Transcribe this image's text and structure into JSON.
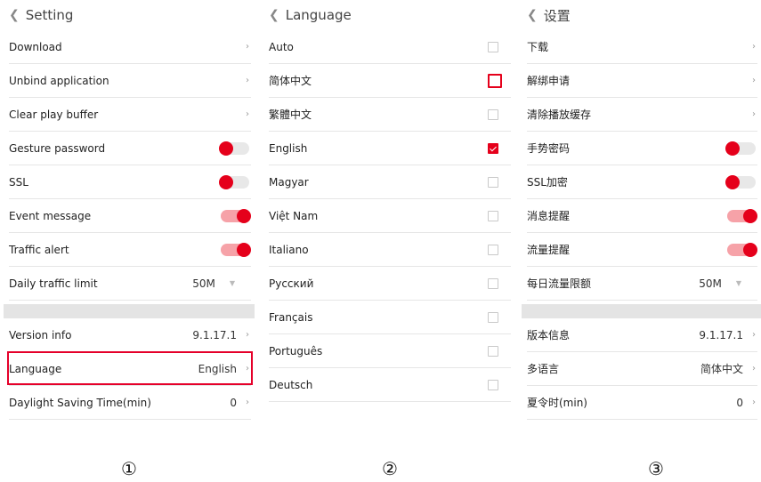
{
  "panel1": {
    "title": "Setting",
    "rows": [
      {
        "label": "Download"
      },
      {
        "label": "Unbind application"
      },
      {
        "label": "Clear play buffer"
      },
      {
        "label": "Gesture password",
        "toggle": "off"
      },
      {
        "label": "SSL",
        "toggle": "off"
      },
      {
        "label": "Event message",
        "toggle": "on"
      },
      {
        "label": "Traffic alert",
        "toggle": "on"
      },
      {
        "label": "Daily traffic limit",
        "value": "50M"
      }
    ],
    "rows2": [
      {
        "label": "Version info",
        "value": "9.1.17.1"
      },
      {
        "label": "Language",
        "value": "English"
      },
      {
        "label": "Daylight Saving Time(min)",
        "value": "0"
      }
    ]
  },
  "panel2": {
    "title": "Language",
    "languages": [
      {
        "label": "Auto",
        "state": "unchecked"
      },
      {
        "label": "简体中文",
        "state": "focus"
      },
      {
        "label": "繁體中文",
        "state": "unchecked"
      },
      {
        "label": "English",
        "state": "checked"
      },
      {
        "label": "Magyar",
        "state": "unchecked"
      },
      {
        "label": "Việt Nam",
        "state": "unchecked"
      },
      {
        "label": "Italiano",
        "state": "unchecked"
      },
      {
        "label": "Русский",
        "state": "unchecked"
      },
      {
        "label": "Français",
        "state": "unchecked"
      },
      {
        "label": "Português",
        "state": "unchecked"
      },
      {
        "label": "Deutsch",
        "state": "unchecked"
      }
    ]
  },
  "panel3": {
    "title": "设置",
    "rows": [
      {
        "label": "下载"
      },
      {
        "label": "解绑申请"
      },
      {
        "label": "清除播放缓存"
      },
      {
        "label": "手势密码",
        "toggle": "off"
      },
      {
        "label": "SSL加密",
        "toggle": "off"
      },
      {
        "label": "消息提醒",
        "toggle": "on"
      },
      {
        "label": "流量提醒",
        "toggle": "on"
      },
      {
        "label": "每日流量限额",
        "value": "50M"
      }
    ],
    "rows2": [
      {
        "label": "版本信息",
        "value": "9.1.17.1"
      },
      {
        "label": "多语言",
        "value": "简体中文"
      },
      {
        "label": "夏令时(min)",
        "value": "0"
      }
    ]
  },
  "labels": [
    "①",
    "②",
    "③"
  ],
  "colors": {
    "accent": "#e5001b",
    "toggle_on_track": "#f6a2a8",
    "toggle_off_track": "#e8e8e8",
    "band": "#e4e4e4"
  }
}
